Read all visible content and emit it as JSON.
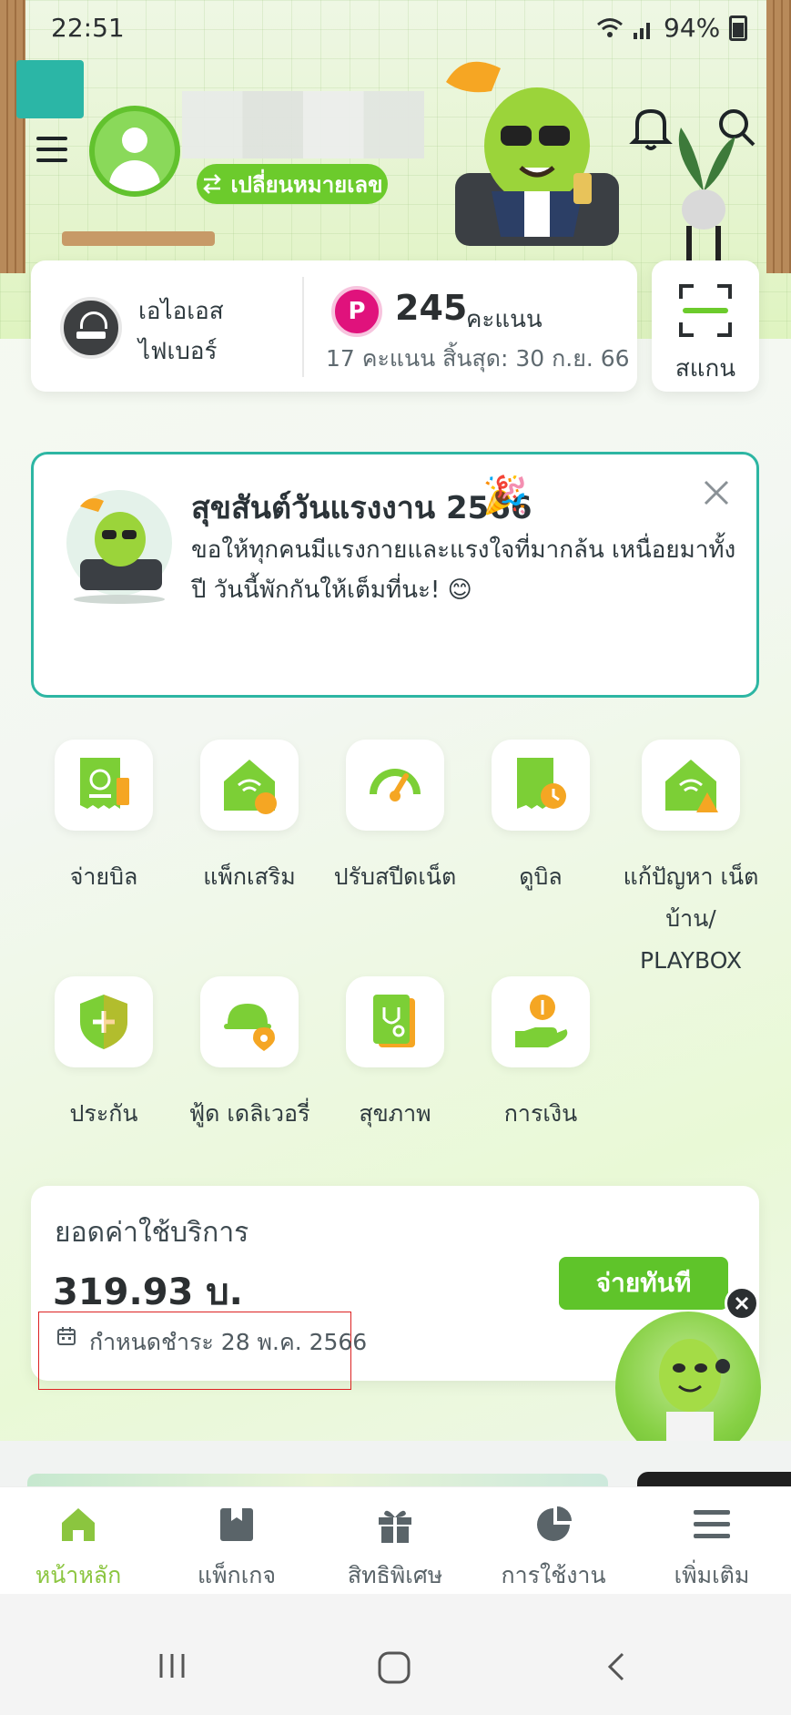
{
  "status_bar": {
    "time": "22:51",
    "battery": "94%"
  },
  "header": {
    "switch_number_label": "เปลี่ยนหมายเลข"
  },
  "account_card": {
    "provider_line1": "เอไอเอส",
    "provider_line2": "ไฟเบอร์",
    "points_badge": "P",
    "points": "245",
    "points_unit": "คะแนน",
    "points_expiry": "17 คะแนน สิ้นสุด: 30 ก.ย. 66",
    "scan_label": "สแกน"
  },
  "announcement": {
    "title": "สุขสันต์วันแรงงาน 2566",
    "body": "ขอให้ทุกคนมีแรงกายและแรงใจที่มากล้น เหนื่อยมาทั้งปี วันนี้พักกันให้เต็มที่นะ! 😊"
  },
  "services": [
    {
      "label": "จ่ายบิล",
      "icon": "bill-pay-icon"
    },
    {
      "label": "แพ็กเสริม",
      "icon": "addon-pack-icon"
    },
    {
      "label": "ปรับสปีดเน็ต",
      "icon": "speed-boost-icon"
    },
    {
      "label": "ดูบิล",
      "icon": "view-bill-icon"
    },
    {
      "label": "แก้ปัญหา เน็ตบ้าน/ PLAYBOX",
      "icon": "troubleshoot-icon"
    },
    {
      "label": "ประกัน",
      "icon": "insurance-icon"
    },
    {
      "label": "ฟู้ด เดลิเวอรี่",
      "icon": "food-delivery-icon"
    },
    {
      "label": "สุขภาพ",
      "icon": "health-icon"
    },
    {
      "label": "การเงิน",
      "icon": "finance-icon"
    }
  ],
  "bill": {
    "title": "ยอดค่าใช้บริการ",
    "amount": "319.93 บ.",
    "pay_now_label": "จ่ายทันที",
    "due_label": "กำหนดชำระ 28 พ.ค. 2566"
  },
  "bottom_nav": [
    {
      "label": "หน้าหลัก",
      "icon": "home-icon",
      "active": true
    },
    {
      "label": "แพ็กเกจ",
      "icon": "package-icon",
      "active": false
    },
    {
      "label": "สิทธิพิเศษ",
      "icon": "gift-icon",
      "active": false
    },
    {
      "label": "การใช้งาน",
      "icon": "usage-icon",
      "active": false
    },
    {
      "label": "เพิ่มเติม",
      "icon": "more-menu-icon",
      "active": false
    }
  ],
  "colors": {
    "brand_green": "#6ccb2c",
    "accent_teal": "#2db6a3",
    "points_pink": "#e0127c",
    "active_nav": "#8bc53f"
  }
}
